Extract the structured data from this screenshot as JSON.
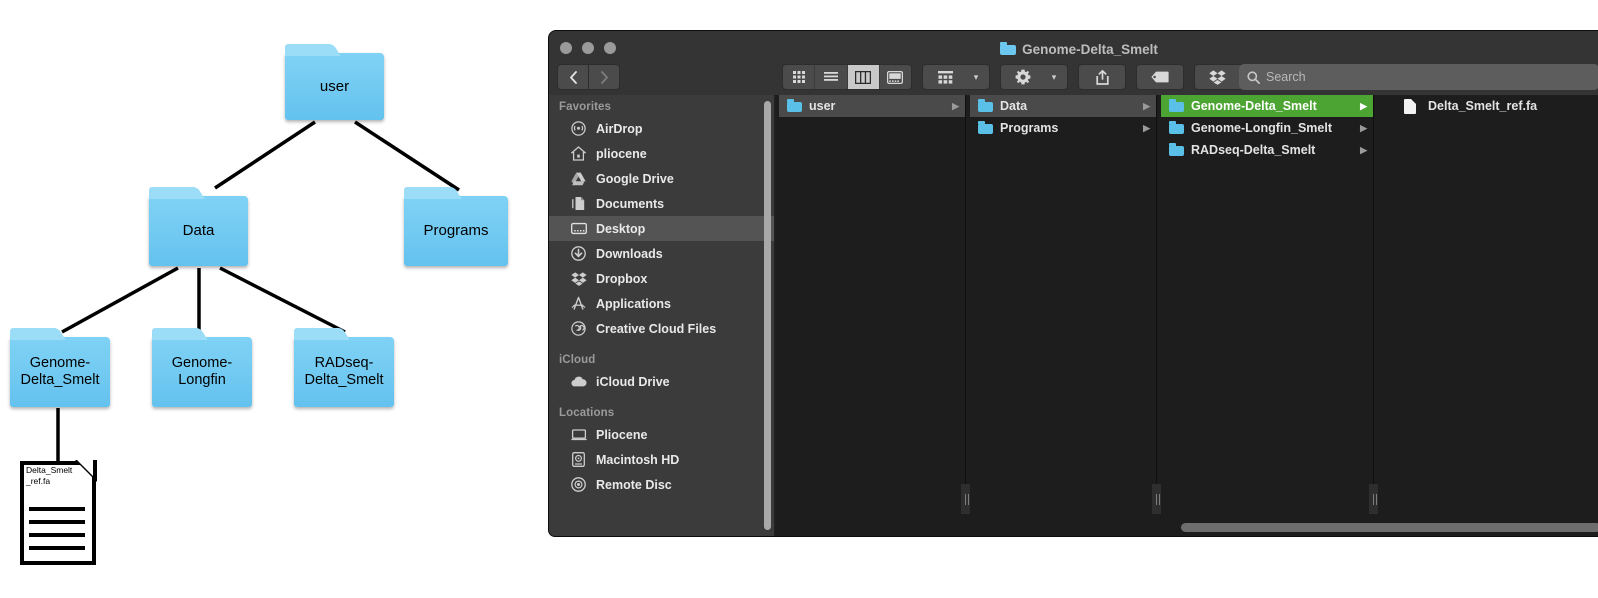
{
  "diagram": {
    "title": "folder-hierarchy-diagram",
    "nodes": [
      {
        "id": "user",
        "label": "user"
      },
      {
        "id": "data",
        "label": "Data"
      },
      {
        "id": "programs",
        "label": "Programs"
      },
      {
        "id": "genome_delta",
        "label": "Genome-\nDelta_Smelt"
      },
      {
        "id": "genome_longfin",
        "label": "Genome-\nLongfin"
      },
      {
        "id": "radseq_delta",
        "label": "RADseq-\nDelta_Smelt"
      }
    ],
    "file_node": {
      "label": "Delta_Smelt\n_ref.fa"
    },
    "folder_color": "#74cbf2",
    "folder_tab_color": "#9bdcf7"
  },
  "finder": {
    "window_title": "Genome-Delta_Smelt",
    "traffic_lights": [
      "close",
      "minimize",
      "zoom"
    ],
    "nav": {
      "back": "‹",
      "forward": "›"
    },
    "toolbar": {
      "views": [
        {
          "name": "icon-view",
          "active": false
        },
        {
          "name": "list-view",
          "active": false
        },
        {
          "name": "column-view",
          "active": true
        },
        {
          "name": "gallery-view",
          "active": false
        }
      ],
      "arrange_label": "arrange",
      "action_label": "action",
      "share_label": "share",
      "tag_label": "tag",
      "dropbox_label": "dropbox"
    },
    "search": {
      "placeholder": "Search",
      "value": ""
    },
    "sidebar": {
      "sections": [
        {
          "header": "Favorites",
          "items": [
            {
              "label": "AirDrop",
              "icon": "airdrop-icon",
              "selected": false
            },
            {
              "label": "pliocene",
              "icon": "home-icon",
              "selected": false
            },
            {
              "label": "Google Drive",
              "icon": "google-drive-icon",
              "selected": false
            },
            {
              "label": "Documents",
              "icon": "documents-icon",
              "selected": false
            },
            {
              "label": "Desktop",
              "icon": "desktop-icon",
              "selected": true
            },
            {
              "label": "Downloads",
              "icon": "downloads-icon",
              "selected": false
            },
            {
              "label": "Dropbox",
              "icon": "dropbox-icon",
              "selected": false
            },
            {
              "label": "Applications",
              "icon": "applications-icon",
              "selected": false
            },
            {
              "label": "Creative Cloud Files",
              "icon": "creative-cloud-icon",
              "selected": false
            }
          ]
        },
        {
          "header": "iCloud",
          "items": [
            {
              "label": "iCloud Drive",
              "icon": "cloud-icon",
              "selected": false
            }
          ]
        },
        {
          "header": "Locations",
          "items": [
            {
              "label": "Pliocene",
              "icon": "laptop-icon",
              "selected": false
            },
            {
              "label": "Macintosh HD",
              "icon": "harddisk-icon",
              "selected": false
            },
            {
              "label": "Remote Disc",
              "icon": "disc-icon",
              "selected": false
            }
          ]
        }
      ]
    },
    "columns": [
      {
        "name": "column-1",
        "rows": [
          {
            "label": "user",
            "kind": "folder",
            "state": "inactive-selected",
            "arrow": true
          }
        ]
      },
      {
        "name": "column-2",
        "rows": [
          {
            "label": "Data",
            "kind": "folder",
            "state": "inactive-selected",
            "arrow": true
          },
          {
            "label": "Programs",
            "kind": "folder",
            "state": "normal",
            "arrow": true
          }
        ]
      },
      {
        "name": "column-3",
        "rows": [
          {
            "label": "Genome-Delta_Smelt",
            "kind": "folder",
            "state": "selected",
            "arrow": true
          },
          {
            "label": "Genome-Longfin_Smelt",
            "kind": "folder",
            "state": "normal",
            "arrow": true
          },
          {
            "label": "RADseq-Delta_Smelt",
            "kind": "folder",
            "state": "normal",
            "arrow": true
          }
        ]
      },
      {
        "name": "column-4",
        "rows": [
          {
            "label": "Delta_Smelt_ref.fa",
            "kind": "file",
            "state": "normal",
            "arrow": false
          }
        ]
      }
    ],
    "colors": {
      "selection_green": "#4ca432",
      "inactive_selection": "#4a4a4a",
      "folder_blue": "#5bc0e8",
      "window_bg": "#1d1d1d",
      "sidebar_bg": "#3b3b3b",
      "titlebar_bg": "#343434"
    }
  }
}
